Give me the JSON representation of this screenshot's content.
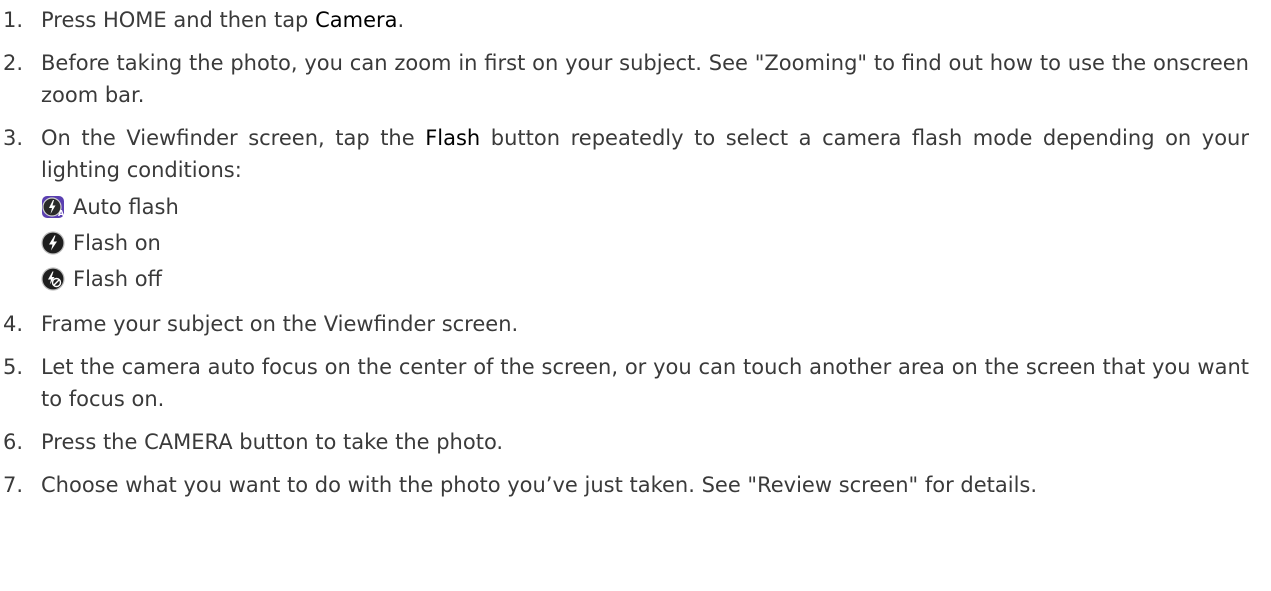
{
  "steps": [
    {
      "num": "1.",
      "pre": "Press HOME and then tap ",
      "bold": "Camera",
      "post": "."
    },
    {
      "num": "2.",
      "text": "Before taking the photo, you can zoom in first on your subject. See \"Zooming\" to find out how to use the onscreen zoom bar."
    },
    {
      "num": "3.",
      "pre": "On the Viewfinder screen, tap the ",
      "bold": "Flash",
      "post": " button repeatedly to select a camera flash mode depending on your lighting conditions:",
      "modes": [
        {
          "icon": "auto-flash-icon",
          "label": "Auto flash"
        },
        {
          "icon": "flash-on-icon",
          "label": "Flash on"
        },
        {
          "icon": "flash-off-icon",
          "label": "Flash off"
        }
      ]
    },
    {
      "num": "4.",
      "text": "Frame your subject on the Viewfinder screen."
    },
    {
      "num": "5.",
      "text": "Let the camera auto focus on the center of the screen, or you can touch another area on the screen that you want to focus on."
    },
    {
      "num": "6.",
      "text": "Press the CAMERA button to take the photo."
    },
    {
      "num": "7.",
      "text": "Choose what you want to do with the photo you’ve just taken. See \"Review screen\" for details."
    }
  ],
  "colors": {
    "text": "#3a3a3a",
    "emphasis": "#000000",
    "auto_flash_bg": "#4a3aa0"
  }
}
